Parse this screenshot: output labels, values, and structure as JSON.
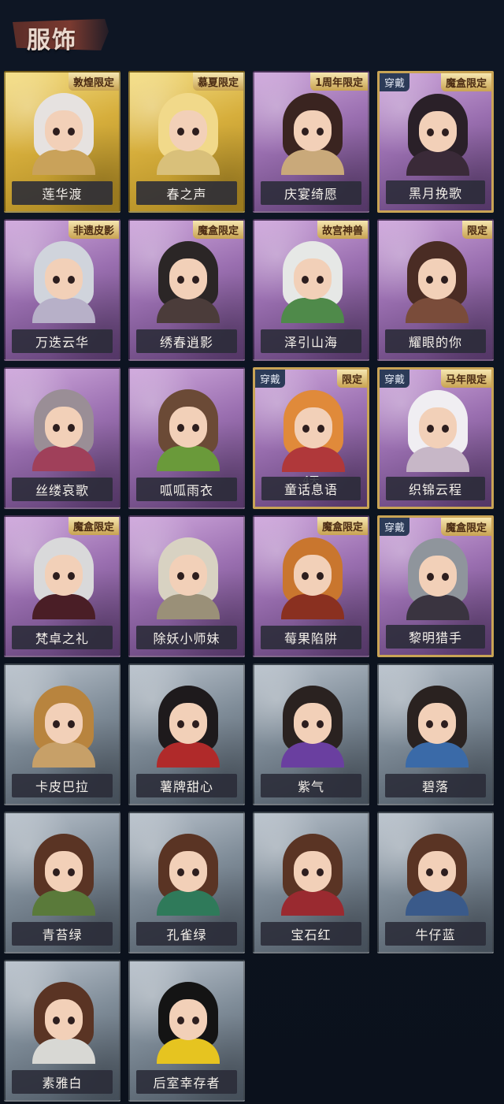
{
  "header": {
    "title": "服饰"
  },
  "cards": [
    {
      "name": "莲华渡",
      "tier": "gold",
      "badge": "敦煌限定",
      "hair": "#e6e2e0",
      "body": "#c9a25a"
    },
    {
      "name": "春之声",
      "tier": "gold",
      "badge": "慕夏限定",
      "hair": "#f1d98a",
      "body": "#d9c07a"
    },
    {
      "name": "庆宴绮愿",
      "tier": "purple",
      "badge": "1周年限定",
      "hair": "#3a2420",
      "body": "#c9a97a"
    },
    {
      "name": "黑月挽歌",
      "tier": "purple",
      "badge": "魔盒限定",
      "worn": "穿戴",
      "hair": "#2a2028",
      "body": "#3a2a38"
    },
    {
      "name": "万迭云华",
      "tier": "purple",
      "badge": "非遗皮影",
      "hair": "#d0d4dc",
      "body": "#b7b0c8"
    },
    {
      "name": "绣春逍影",
      "tier": "purple",
      "badge": "魔盒限定",
      "hair": "#2b2626",
      "body": "#4b3c3a"
    },
    {
      "name": "泽引山海",
      "tier": "purple",
      "badge": "故宫神兽",
      "hair": "#e6e8e6",
      "body": "#4f8a4a"
    },
    {
      "name": "耀眼的你",
      "tier": "purple",
      "badge": "限定",
      "hair": "#4a2c24",
      "body": "#7a4c3a"
    },
    {
      "name": "丝缕哀歌",
      "tier": "purple",
      "hair": "#9a8e96",
      "body": "#a0405a"
    },
    {
      "name": "呱呱雨衣",
      "tier": "purple",
      "hair": "#6b4a36",
      "body": "#6a9a3a"
    },
    {
      "name": "童话息语",
      "tier": "purple",
      "badge": "限定",
      "worn": "穿戴",
      "timer": "4天",
      "hair": "#e08a3a",
      "body": "#b0383a"
    },
    {
      "name": "织锦云程",
      "tier": "purple",
      "badge": "马年限定",
      "worn": "穿戴",
      "hair": "#f0eef2",
      "body": "#c7b7c7"
    },
    {
      "name": "梵卓之礼",
      "tier": "purple",
      "badge": "魔盒限定",
      "hair": "#d9d9da",
      "body": "#4a1e26"
    },
    {
      "name": "除妖小师妹",
      "tier": "purple",
      "hair": "#d8d2c2",
      "body": "#9a9078"
    },
    {
      "name": "莓果陷阱",
      "tier": "purple",
      "badge": "魔盒限定",
      "hair": "#c9762e",
      "body": "#8a3020"
    },
    {
      "name": "黎明猎手",
      "tier": "purple",
      "badge": "魔盒限定",
      "worn": "穿戴",
      "hair": "#8f959c",
      "body": "#3a3440"
    },
    {
      "name": "卡皮巴拉",
      "tier": "gray",
      "hair": "#b8843e",
      "body": "#c7a068"
    },
    {
      "name": "薯牌甜心",
      "tier": "gray",
      "hair": "#1e1a1c",
      "body": "#b02a2a"
    },
    {
      "name": "紫气",
      "tier": "gray",
      "hair": "#2a2220",
      "body": "#6a3fa0"
    },
    {
      "name": "碧落",
      "tier": "gray",
      "hair": "#2a2220",
      "body": "#3a6aa8"
    },
    {
      "name": "青苔绿",
      "tier": "gray",
      "hair": "#5a3424",
      "body": "#5a7a3a"
    },
    {
      "name": "孔雀绿",
      "tier": "gray",
      "hair": "#5a3424",
      "body": "#2f7a5a"
    },
    {
      "name": "宝石红",
      "tier": "gray",
      "hair": "#5a3424",
      "body": "#9a2a30"
    },
    {
      "name": "牛仔蓝",
      "tier": "gray",
      "hair": "#5a3424",
      "body": "#3a5a8a"
    },
    {
      "name": "素雅白",
      "tier": "gray",
      "hair": "#5a3424",
      "body": "#d8d8d4"
    },
    {
      "name": "后室幸存者",
      "tier": "gray",
      "hair": "#141414",
      "body": "#e6c420"
    }
  ]
}
